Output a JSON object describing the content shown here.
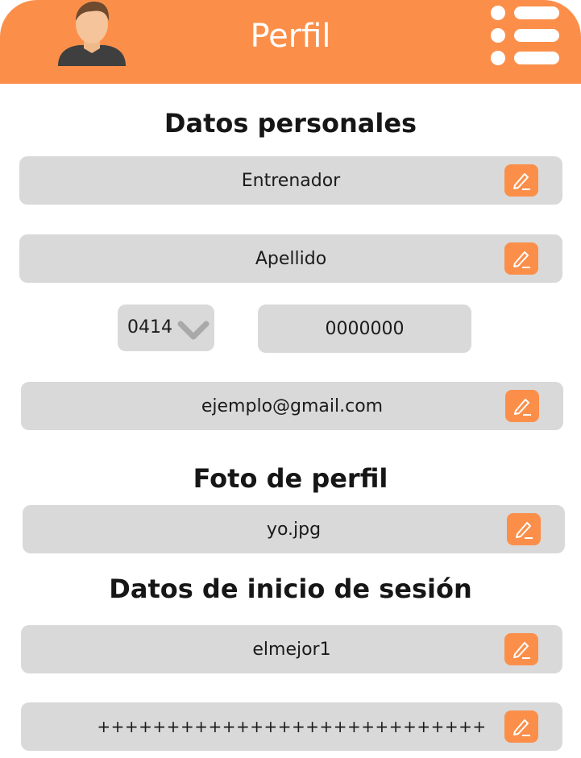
{
  "header": {
    "title": "Perfil",
    "accent_color": "#fb8f4a",
    "avatar_icon": "user-avatar-icon",
    "menu_icon": "list-menu-icon"
  },
  "sections": {
    "personal": "Datos personales",
    "photo": "Foto de perfil",
    "login": "Datos de inicio de sesión"
  },
  "fields": {
    "first_name": "Entrenador",
    "last_name": "Apellido",
    "phone_code": "0414",
    "phone_number": "0000000",
    "email": "ejemplo@gmail.com",
    "photo_file": "yo.jpg",
    "username": "elmejor1",
    "password": "++++++++++++++++++++++++++++"
  },
  "icons": {
    "edit": "pencil-edit-icon",
    "dropdown": "chevron-down-icon"
  }
}
